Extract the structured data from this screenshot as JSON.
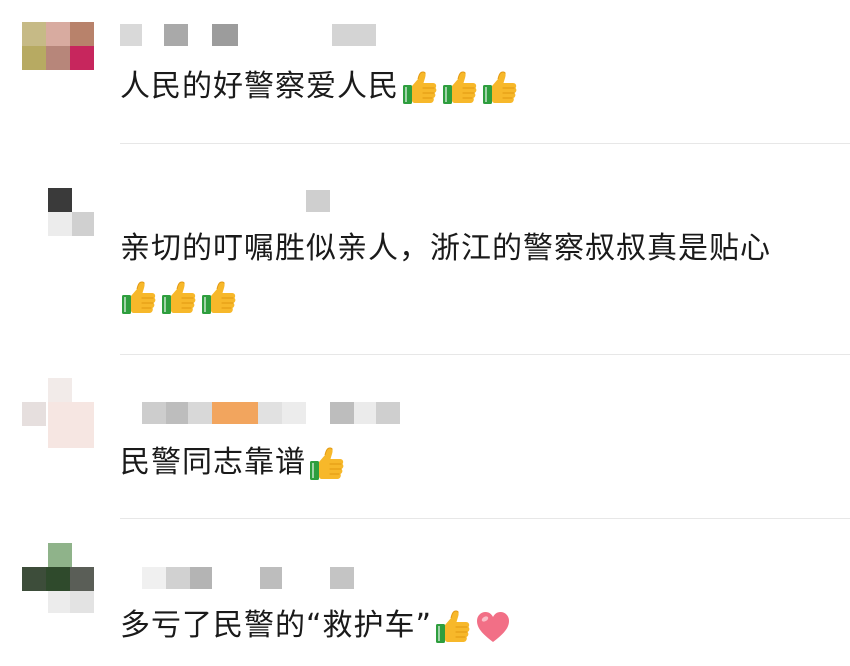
{
  "comments": [
    {
      "text": "人民的好警察爱人民",
      "emojis": [
        "thumbs-up",
        "thumbs-up",
        "thumbs-up"
      ]
    },
    {
      "text": "亲切的叮嘱胜似亲人，浙江的警察叔叔真是贴心",
      "emojis": [
        "thumbs-up",
        "thumbs-up",
        "thumbs-up"
      ]
    },
    {
      "text": "民警同志靠谱",
      "emojis": [
        "thumbs-up"
      ]
    },
    {
      "text": "多亏了民警的“救护车”",
      "emojis": [
        "thumbs-up",
        "red-heart"
      ]
    }
  ],
  "colors": {
    "thumb_yellow": "#f7b82a",
    "thumb_cuff": "#2e9e3e",
    "heart_pink": "#f26f86",
    "divider": "#e7e7e7"
  }
}
